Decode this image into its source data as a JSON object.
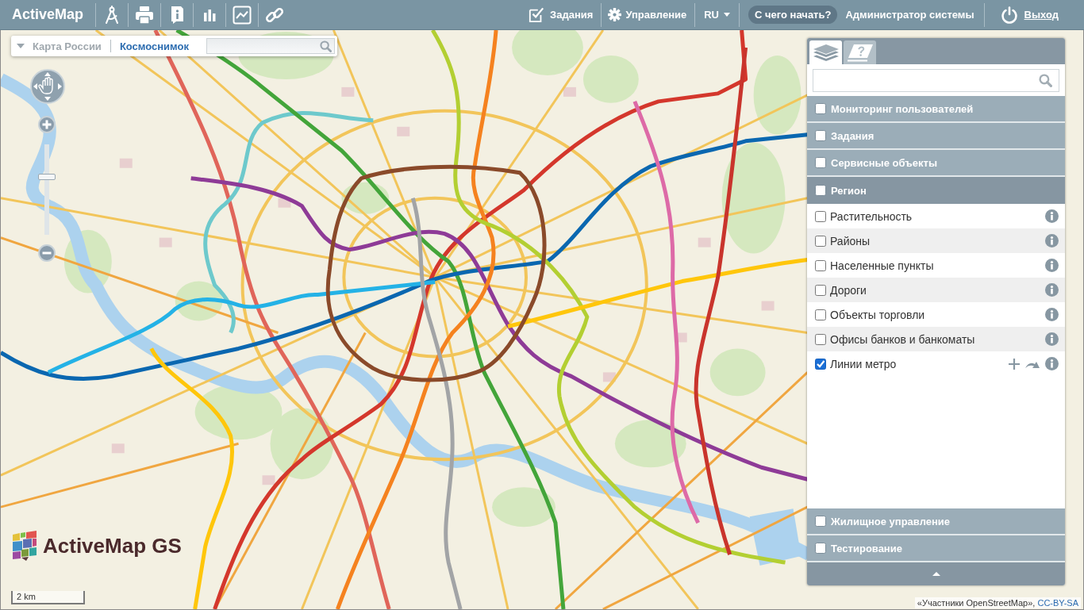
{
  "header": {
    "logo": "ActiveMap",
    "menu": [
      {
        "kind": "tasks",
        "label": "Задания"
      },
      {
        "kind": "settings",
        "label": "Управление"
      },
      {
        "kind": "language",
        "label": "RU"
      }
    ],
    "help_button": "С чего начать?",
    "user": "Администратор системы",
    "logout": "Выход"
  },
  "map": {
    "layer_switcher": {
      "layers": [
        {
          "label": "Карта России",
          "selected": false
        },
        {
          "label": "Космоснимок",
          "selected": true
        }
      ]
    },
    "zoom": {
      "level": 0.65
    },
    "logo": "ActiveMap GS",
    "scale": "2 km",
    "attribution": {
      "text": "«Участники OpenStreetMap»,",
      "link": "CC-BY-SA"
    }
  },
  "panel": {
    "tabs": [
      {
        "kind": "layers",
        "selected": true
      },
      {
        "kind": "help",
        "selected": false
      }
    ],
    "groups": [
      {
        "label": "Мониторинг пользователей",
        "checked": false,
        "expanded": false
      },
      {
        "label": "Задания",
        "checked": false,
        "expanded": false
      },
      {
        "label": "Сервисные объекты",
        "checked": false,
        "expanded": false
      },
      {
        "label": "Регион",
        "checked": false,
        "expanded": true,
        "children": [
          {
            "label": "Растительность",
            "checked": false
          },
          {
            "label": "Районы",
            "checked": false
          },
          {
            "label": "Населенные пункты",
            "checked": false
          },
          {
            "label": "Дороги",
            "checked": false
          },
          {
            "label": "Объекты торговли",
            "checked": false
          },
          {
            "label": "Офисы банков и банкоматы",
            "checked": false
          },
          {
            "label": "Линии метро",
            "checked": true
          }
        ]
      },
      {
        "label": "Жилищное управление",
        "checked": false,
        "expanded": false
      },
      {
        "label": "Тестирование",
        "checked": false,
        "expanded": false
      }
    ]
  }
}
